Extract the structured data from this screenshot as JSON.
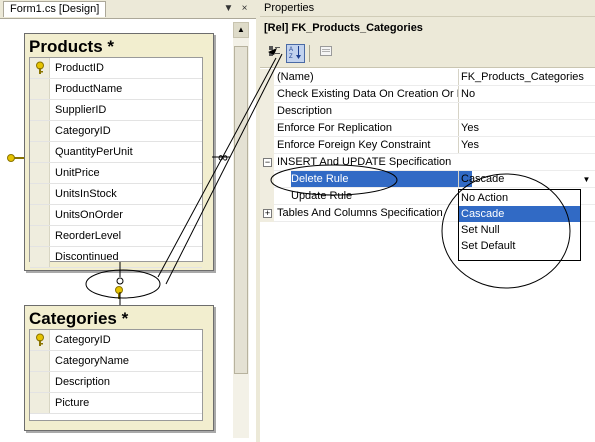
{
  "designer": {
    "tab_label": "Form1.cs [Design]",
    "dropdown_glyph": "▼",
    "close_glyph": "×",
    "tables": {
      "products": {
        "title": "Products *",
        "columns": [
          {
            "name": "ProductID",
            "key": true
          },
          {
            "name": "ProductName",
            "key": false
          },
          {
            "name": "SupplierID",
            "key": false
          },
          {
            "name": "CategoryID",
            "key": false
          },
          {
            "name": "QuantityPerUnit",
            "key": false
          },
          {
            "name": "UnitPrice",
            "key": false
          },
          {
            "name": "UnitsInStock",
            "key": false
          },
          {
            "name": "UnitsOnOrder",
            "key": false
          },
          {
            "name": "ReorderLevel",
            "key": false
          },
          {
            "name": "Discontinued",
            "key": false
          }
        ]
      },
      "categories": {
        "title": "Categories *",
        "columns": [
          {
            "name": "CategoryID",
            "key": true
          },
          {
            "name": "CategoryName",
            "key": false
          },
          {
            "name": "Description",
            "key": false
          },
          {
            "name": "Picture",
            "key": false
          }
        ]
      }
    },
    "key_icon": "key-icon",
    "infinity_glyph": "∞"
  },
  "properties": {
    "title": "Properties",
    "object": "[Rel] FK_Products_Categories",
    "toolbar": {
      "categorized": "categorized-icon",
      "alphabetical": "alphabetical-sort-icon",
      "property_pages": "property-pages-icon"
    },
    "rows": [
      {
        "name": "(Name)",
        "value": "FK_Products_Categories",
        "type": "prop"
      },
      {
        "name": "Check Existing Data On Creation Or Re-Enabling",
        "value": "No",
        "type": "prop"
      },
      {
        "name": "Description",
        "value": "",
        "type": "prop"
      },
      {
        "name": "Enforce For Replication",
        "value": "Yes",
        "type": "prop"
      },
      {
        "name": "Enforce Foreign Key Constraint",
        "value": "Yes",
        "type": "prop"
      },
      {
        "name": "INSERT And UPDATE Specification",
        "value": "",
        "type": "group",
        "expander": "−"
      },
      {
        "name": "Delete Rule",
        "value": "Cascade",
        "type": "sub",
        "selected": true
      },
      {
        "name": "Update Rule",
        "value": "",
        "type": "sub"
      },
      {
        "name": "Tables And Columns Specification",
        "value": "",
        "type": "group",
        "expander": "+"
      }
    ],
    "dropdown": {
      "options": [
        "No Action",
        "Cascade",
        "Set Null",
        "Set Default"
      ],
      "selected": "Cascade"
    }
  },
  "colors": {
    "selection": "#316ac5",
    "table_header": "#f2eecf",
    "chrome": "#ece9d8"
  }
}
